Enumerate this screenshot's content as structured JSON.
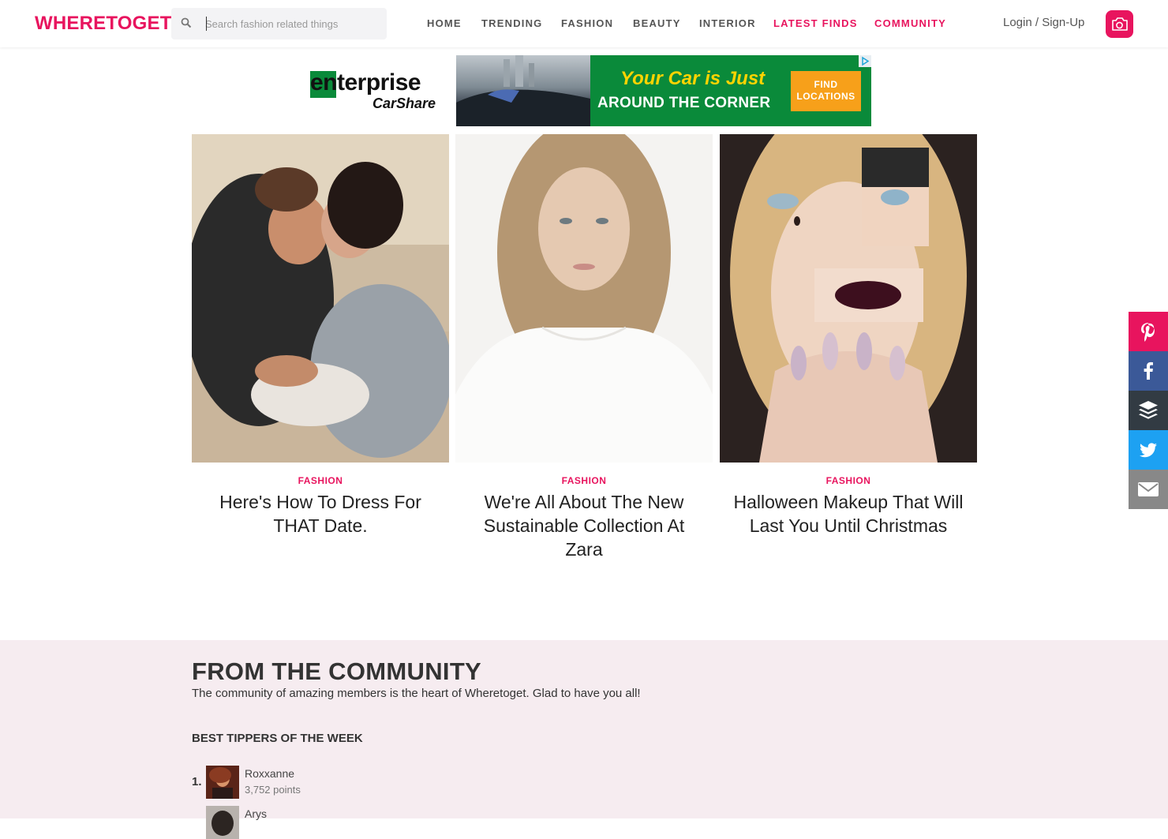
{
  "header": {
    "logo": "WHERETOGET",
    "search_placeholder": "Search fashion related things",
    "nav": [
      {
        "label": "HOME"
      },
      {
        "label": "TRENDING"
      },
      {
        "label": "FASHION"
      },
      {
        "label": "BEAUTY"
      },
      {
        "label": "INTERIOR"
      },
      {
        "label": "LATEST FINDS"
      },
      {
        "label": "COMMUNITY"
      }
    ],
    "login": "Login / Sign-Up",
    "camera_icon": "camera-icon"
  },
  "ad": {
    "brand": "enterprise",
    "brand_sub": "CarShare",
    "headline": "Your Car is Just",
    "subline": "AROUND THE CORNER",
    "button_line1": "FIND",
    "button_line2": "LOCATIONS",
    "colors": {
      "green": "#0a8a3a",
      "yellow": "#ffd400",
      "orange": "#f7a01a"
    }
  },
  "cards": [
    {
      "category": "FASHION",
      "title": "Here's How To Dress For THAT Date."
    },
    {
      "category": "FASHION",
      "title": "We're All About The New Sustainable Collection At Zara"
    },
    {
      "category": "FASHION",
      "title": "Halloween Makeup That Will Last You Until Christmas"
    }
  ],
  "share": [
    {
      "icon": "pinterest-icon",
      "color": "#e8145e"
    },
    {
      "icon": "facebook-icon",
      "color": "#3b5998"
    },
    {
      "icon": "buffer-icon",
      "color": "#323b43"
    },
    {
      "icon": "twitter-icon",
      "color": "#1da1f2"
    },
    {
      "icon": "email-icon",
      "color": "#888888"
    }
  ],
  "community": {
    "title": "FROM THE COMMUNITY",
    "subtitle": "The community of amazing members is the heart of Wheretoget. Glad to have you all!",
    "tippers_title": "BEST TIPPERS OF THE WEEK",
    "tippers": [
      {
        "rank": "1.",
        "name": "Roxxanne",
        "points": "3,752 points"
      },
      {
        "rank": "",
        "name": "Arys",
        "points": ""
      }
    ]
  },
  "colors": {
    "accent": "#e8145e",
    "community_bg": "#f6ecf0"
  }
}
